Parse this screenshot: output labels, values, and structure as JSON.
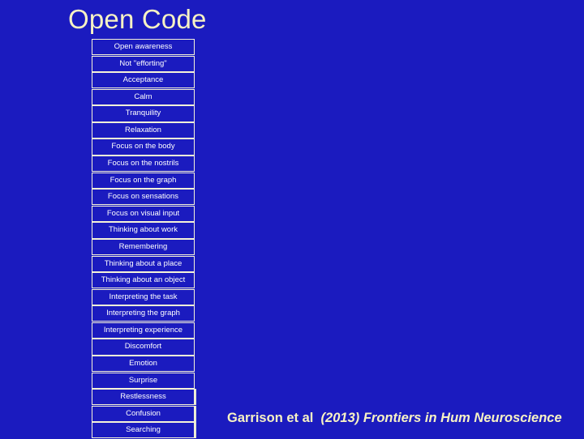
{
  "slide": {
    "title": "Open Code",
    "background_color": "#1b1bbf",
    "title_color": "#f7f2c4",
    "box_border_color": "#f6f3d8",
    "box_text_color": "#ffffff"
  },
  "code_list": {
    "items": [
      {
        "label": "Open awareness",
        "shadowed": false
      },
      {
        "label": "Not \"efforting\"",
        "shadowed": false
      },
      {
        "label": "Acceptance",
        "shadowed": false
      },
      {
        "label": "Calm",
        "shadowed": false
      },
      {
        "label": "Tranquility",
        "shadowed": false
      },
      {
        "label": "Relaxation",
        "shadowed": false
      },
      {
        "label": "Focus on the body",
        "shadowed": false
      },
      {
        "label": "Focus on the nostrils",
        "shadowed": false
      },
      {
        "label": "Focus on the graph",
        "shadowed": false
      },
      {
        "label": "Focus on sensations",
        "shadowed": false
      },
      {
        "label": "Focus on visual input",
        "shadowed": false
      },
      {
        "label": "Thinking about work",
        "shadowed": false
      },
      {
        "label": "Remembering",
        "shadowed": false
      },
      {
        "label": "Thinking about a place",
        "shadowed": false
      },
      {
        "label": "Thinking about an object",
        "shadowed": false
      },
      {
        "label": "Interpreting the task",
        "shadowed": false
      },
      {
        "label": "Interpreting the graph",
        "shadowed": false
      },
      {
        "label": "Interpreting experience",
        "shadowed": false
      },
      {
        "label": "Discomfort",
        "shadowed": false
      },
      {
        "label": "Emotion",
        "shadowed": false
      },
      {
        "label": "Surprise",
        "shadowed": false
      },
      {
        "label": "Restlessness",
        "shadowed": true
      },
      {
        "label": "Confusion",
        "shadowed": true
      },
      {
        "label": "Searching",
        "shadowed": true
      }
    ]
  },
  "citation": {
    "authors": "Garrison et al",
    "journal": "(2013) Frontiers in Hum Neuroscience"
  }
}
